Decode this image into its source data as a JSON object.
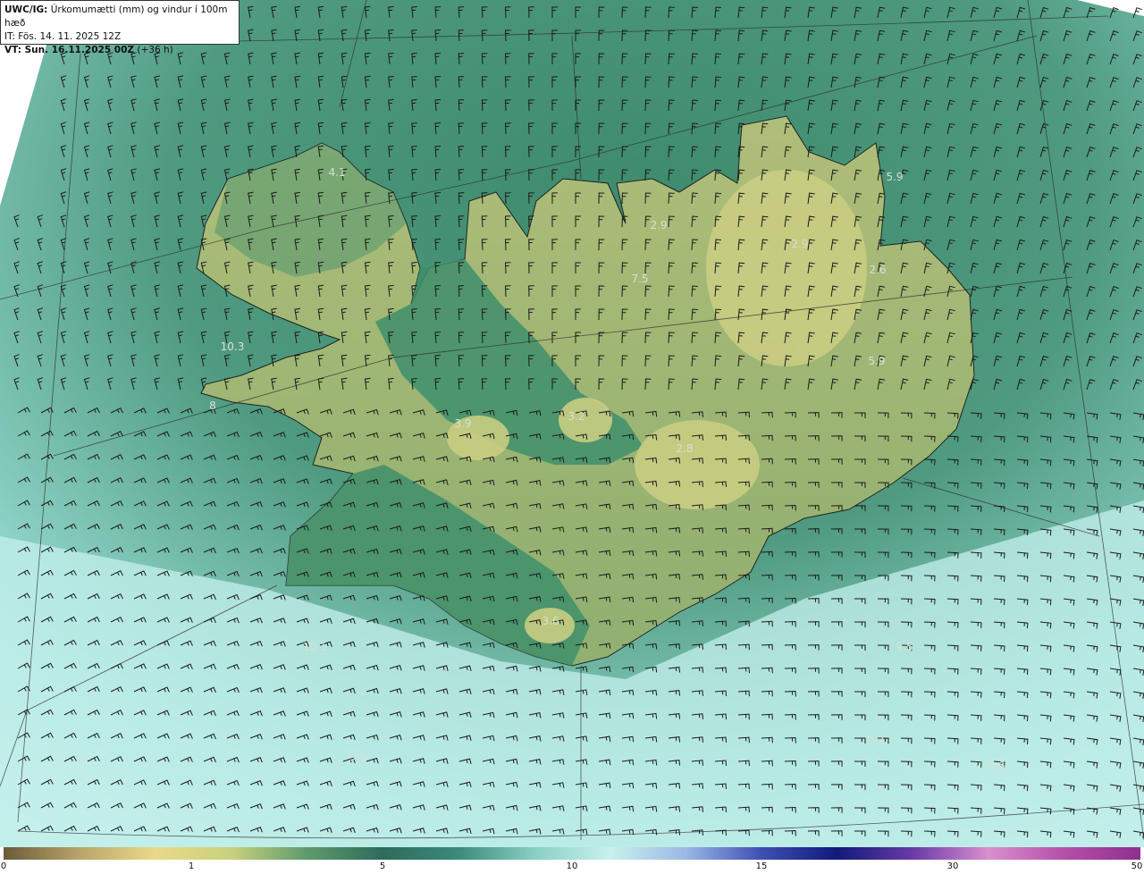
{
  "title": {
    "product": "UWC/IG:",
    "description": "Úrkomumætti (mm) og vindur í 100m hæð",
    "issue_time": "IT: Fös. 14. 11. 2025 12Z",
    "valid_label": "VT: Sun. 16.11.2025 00Z",
    "lead": "(+36 h)"
  },
  "map_values": [
    "4.1",
    "2.9",
    "2.9",
    "2.6",
    "5.9",
    "7.5",
    "5.9",
    "10.3",
    "8",
    "3.9",
    "3.2",
    "2.8",
    "3.6",
    "10.1",
    "9.5",
    "9.3",
    "8.7",
    "8.6"
  ],
  "colorbar": {
    "ticks": [
      "0",
      "1",
      "5",
      "10",
      "15",
      "30",
      "50"
    ],
    "stops": [
      "#6b5a3a",
      "#b8a56a",
      "#e9d98a",
      "#c7d27d",
      "#5f9a6d",
      "#2f6b5c",
      "#3b8a7a",
      "#88cfc4",
      "#c8f1ee",
      "#9bb8e6",
      "#3e4fb2",
      "#101a7a",
      "#6a3aa8",
      "#d98fcf",
      "#b44fa8",
      "#8f2f8f"
    ]
  }
}
